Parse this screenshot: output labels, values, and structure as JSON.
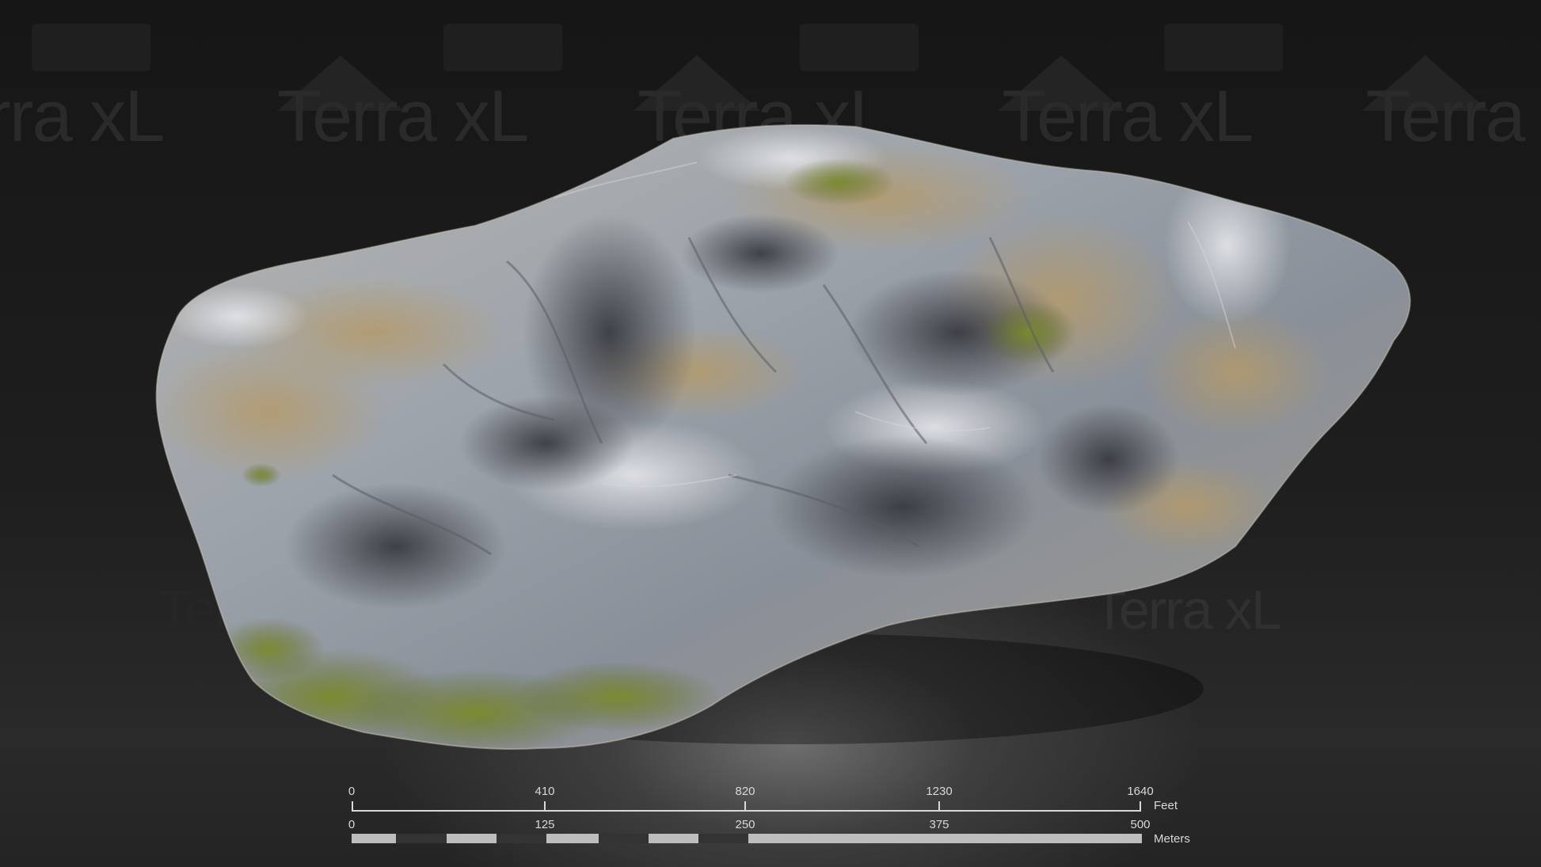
{
  "watermark": {
    "text": "Terra xL"
  },
  "scale_bar": {
    "feet": {
      "ticks": [
        "0",
        "410",
        "820",
        "1230",
        "1640"
      ],
      "unit": "Feet"
    },
    "meters": {
      "ticks": [
        "0",
        "125",
        "250",
        "375",
        "500"
      ],
      "unit": "Meters"
    }
  },
  "colors": {
    "background": "#141414",
    "rock": "#9aa0a8",
    "vegetation": "#7a8a2a",
    "dry_grass": "#b49a6a",
    "scale_text": "#d8d8d8"
  }
}
